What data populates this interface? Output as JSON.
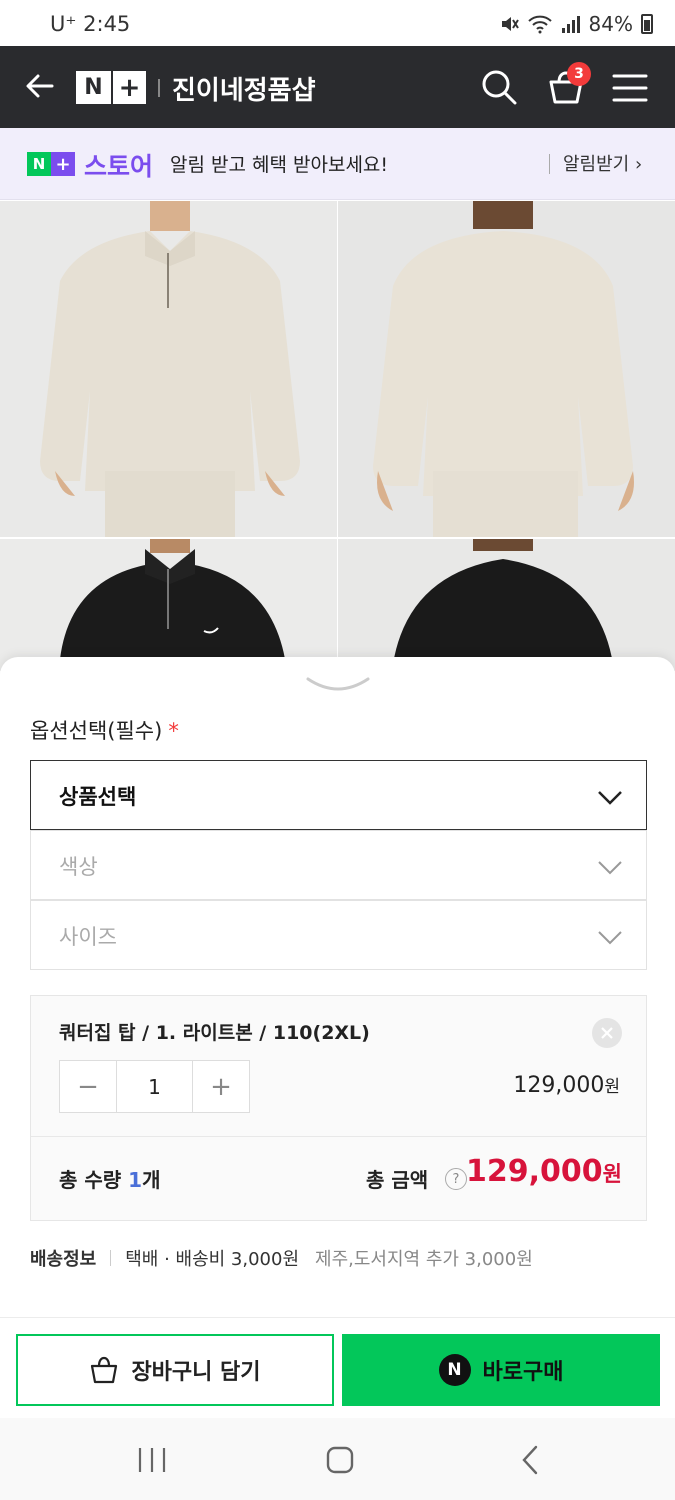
{
  "status_bar": {
    "carrier_time": "U⁺ 2:45",
    "battery": "84%"
  },
  "header": {
    "logo_n": "N",
    "logo_plus": "+",
    "shop_name": "진이네정품샵",
    "cart_count": "3"
  },
  "banner": {
    "logo_n": "N",
    "logo_plus": "+",
    "store_label": "스토어",
    "message": "알림 받고 혜택 받아보세요!",
    "alarm_button": "알림받기 ›"
  },
  "options": {
    "label": "옵션선택(필수)",
    "required_mark": "*",
    "product_select": "상품선택",
    "color_select": "색상",
    "size_select": "사이즈"
  },
  "selected_item": {
    "name": "쿼터집 탑 / 1. 라이트본 / 110(2XL)",
    "quantity": "1",
    "price": "129,000",
    "currency": "원",
    "minus": "−",
    "plus": "+"
  },
  "totals": {
    "qty_prefix": "총 수량 ",
    "qty_value": "1",
    "qty_suffix": "개",
    "amount_label": "총 금액",
    "help": "?",
    "amount": "129,000",
    "currency": "원"
  },
  "shipping": {
    "title": "배송정보",
    "info": "택배 · 배송비 3,000원",
    "extra": "제주,도서지역 추가 3,000원"
  },
  "actions": {
    "cart_button": "장바구니 담기",
    "buy_button": "바로구매",
    "buy_icon_letter": "N"
  },
  "colors": {
    "header_bg": "#2a2b2e",
    "naver_green": "#03c75a",
    "store_purple": "#7b4dee",
    "price_red": "#d7133b",
    "badge_red": "#f33b3b"
  }
}
